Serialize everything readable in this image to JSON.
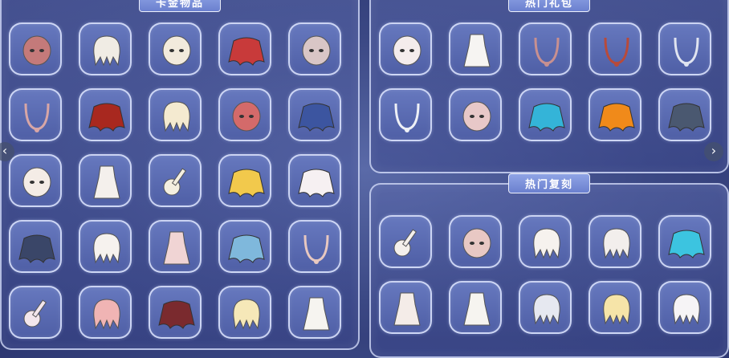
{
  "left_panel": {
    "title": "卡金物品",
    "items": [
      {
        "icon": "dragon-mask-icon"
      },
      {
        "icon": "horned-hair-icon"
      },
      {
        "icon": "tribal-mask-icon"
      },
      {
        "icon": "red-wings-cape-icon"
      },
      {
        "icon": "penguin-hat-icon"
      },
      {
        "icon": "pendant-necklace-icon"
      },
      {
        "icon": "red-cape-icon"
      },
      {
        "icon": "cat-ear-hair-icon"
      },
      {
        "icon": "demon-mask-icon"
      },
      {
        "icon": "blue-cape-icon"
      },
      {
        "icon": "round-mask-icon"
      },
      {
        "icon": "white-hat-icon"
      },
      {
        "icon": "trumpet-icon"
      },
      {
        "icon": "yellow-cape-icon"
      },
      {
        "icon": "white-cape-icon"
      },
      {
        "icon": "spiked-cape-icon"
      },
      {
        "icon": "long-hair-icon"
      },
      {
        "icon": "dress-icon"
      },
      {
        "icon": "light-blue-cape-icon"
      },
      {
        "icon": "scarf-icon"
      },
      {
        "icon": "ornament-icon"
      },
      {
        "icon": "shell-hair-icon"
      },
      {
        "icon": "maroon-cape-icon"
      },
      {
        "icon": "spiky-hair-icon"
      },
      {
        "icon": "robe-outfit-icon"
      }
    ]
  },
  "right_top_panel": {
    "title": "热门礼包",
    "items": [
      {
        "icon": "mouse-hat-icon"
      },
      {
        "icon": "white-top-icon"
      },
      {
        "icon": "necklace-icon"
      },
      {
        "icon": "antler-accessory-icon"
      },
      {
        "icon": "chain-necklace-icon"
      },
      {
        "icon": "crown-necklace-icon"
      },
      {
        "icon": "bunny-mask-icon"
      },
      {
        "icon": "cyan-cape-icon"
      },
      {
        "icon": "orange-cape-icon"
      },
      {
        "icon": "gray-cape-icon"
      }
    ]
  },
  "right_bottom_panel": {
    "title": "热门复刻",
    "items": [
      {
        "icon": "guitar-icon"
      },
      {
        "icon": "round-face-mask-icon"
      },
      {
        "icon": "bob-hair-icon"
      },
      {
        "icon": "ponytail-hair-icon"
      },
      {
        "icon": "cyan-ornament-icon"
      },
      {
        "icon": "outfit-icon"
      },
      {
        "icon": "pants-icon"
      },
      {
        "icon": "wavy-hair-icon"
      },
      {
        "icon": "blonde-hair-icon"
      },
      {
        "icon": "fox-hair-icon"
      }
    ]
  },
  "nav": {
    "prev": "‹",
    "next": "›"
  }
}
